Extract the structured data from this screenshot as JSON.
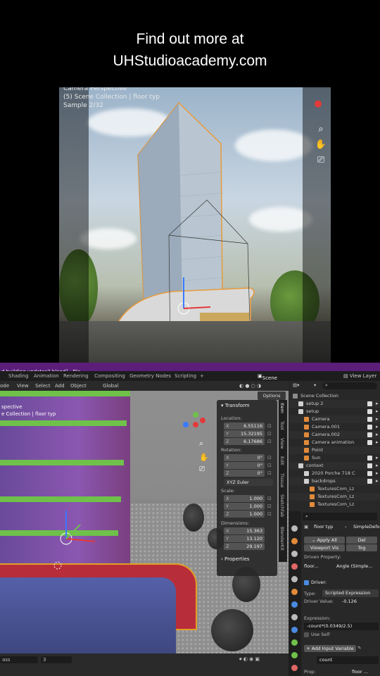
{
  "caption": {
    "line1": "Find out more at",
    "line2": "UHStudioacademy.com"
  },
  "render_view": {
    "line1": "Camera Perspective",
    "line2": "(5) Scene Collection | floor typ",
    "line3": "Sample 2/32"
  },
  "window": {
    "title": "d building updates2.blend] - Ble",
    "menus": [
      "Shading",
      "Animation",
      "Rendering",
      "Compositing",
      "Geometry Nodes",
      "Scripting",
      "+"
    ],
    "scene_label": "Scene",
    "view_layer_label": "View Layer"
  },
  "viewport_header": {
    "mode": "ode",
    "items": [
      "View",
      "Select",
      "Add",
      "Object"
    ],
    "orientation": "Global"
  },
  "viewport": {
    "line1": "spective",
    "line2": "e Collection | floor typ",
    "options_label": "Options"
  },
  "npanel": {
    "title": "Transform",
    "location_label": "Location:",
    "location": [
      {
        "axis": "X",
        "value": "6.55116"
      },
      {
        "axis": "Y",
        "value": "15.32195"
      },
      {
        "axis": "Z",
        "value": "6.17686"
      }
    ],
    "rotation_label": "Rotation:",
    "rotation": [
      {
        "axis": "X",
        "value": "0°"
      },
      {
        "axis": "Y",
        "value": "0°"
      },
      {
        "axis": "Z",
        "value": "0°"
      }
    ],
    "rotation_mode": "XYZ Euler",
    "scale_label": "Scale:",
    "scale": [
      {
        "axis": "X",
        "value": "1.000"
      },
      {
        "axis": "Y",
        "value": "1.000"
      },
      {
        "axis": "Z",
        "value": "1.000"
      }
    ],
    "dimensions_label": "Dimensions:",
    "dimensions": [
      {
        "axis": "X",
        "value": "15.363"
      },
      {
        "axis": "Y",
        "value": "13.120"
      },
      {
        "axis": "Z",
        "value": "29.197"
      }
    ],
    "properties_label": "Properties"
  },
  "sidebar_tabs": [
    "Item",
    "Tool",
    "View",
    "Edit",
    "Tissue",
    "Sketchfab",
    "BlenderKit"
  ],
  "status": {
    "search": "ass",
    "frame": "3"
  },
  "outliner": {
    "rows": [
      {
        "label": "Scene Collection",
        "indent": 0,
        "icon": "#8a8a8a",
        "check": false
      },
      {
        "label": "setup 2",
        "indent": 1,
        "icon": "#cfcfcf",
        "check": true
      },
      {
        "label": "setup",
        "indent": 1,
        "icon": "#cfcfcf",
        "check": true
      },
      {
        "label": "Camera",
        "indent": 2,
        "icon": "#e08a3a",
        "check": true
      },
      {
        "label": "Camera.001",
        "indent": 2,
        "icon": "#e08a3a",
        "check": true
      },
      {
        "label": "Camera.002",
        "indent": 2,
        "icon": "#e08a3a",
        "check": true
      },
      {
        "label": "Camera animation",
        "indent": 2,
        "icon": "#e08a3a",
        "check": true
      },
      {
        "label": "Point",
        "indent": 2,
        "icon": "#e08a3a",
        "check": false
      },
      {
        "label": "Sun",
        "indent": 2,
        "icon": "#e08a3a",
        "check": true
      },
      {
        "label": "context",
        "indent": 1,
        "icon": "#cfcfcf",
        "check": true
      },
      {
        "label": "2020 Porche 718 C",
        "indent": 2,
        "icon": "#cfcfcf",
        "check": true
      },
      {
        "label": "backdrops",
        "indent": 2,
        "icon": "#cfcfcf",
        "check": true
      },
      {
        "label": "TexturesCom_Lz",
        "indent": 3,
        "icon": "#e08a3a",
        "check": false
      },
      {
        "label": "TexturesCom_Lz",
        "indent": 3,
        "icon": "#e08a3a",
        "check": false
      },
      {
        "label": "TexturesCom_Lz",
        "indent": 3,
        "icon": "#e08a3a",
        "check": false
      }
    ]
  },
  "properties": {
    "object_name": "floor typ",
    "modifier": "SimpleDefor",
    "apply_all": "Apply All",
    "delete": "Del",
    "viewport_vis": "Viewport Vis",
    "toggle": "Tog",
    "driven_property_label": "Driven Property:",
    "driven_obj": "floor...",
    "driven_prop": "Angle (Simple...",
    "driver_label": "Driver:",
    "type_label": "Type:",
    "type_value": "Scripted Expression",
    "driver_value_label": "Driver Value:",
    "driver_value": "-0.126",
    "expression_label": "Expression:",
    "expression": "-count*(0.0349/2.5)",
    "use_self": "Use Self",
    "add_input_variable": "Add Input Variable",
    "variable_name": "count",
    "prop_label": "Prop:",
    "prop_value": "floor ..."
  }
}
